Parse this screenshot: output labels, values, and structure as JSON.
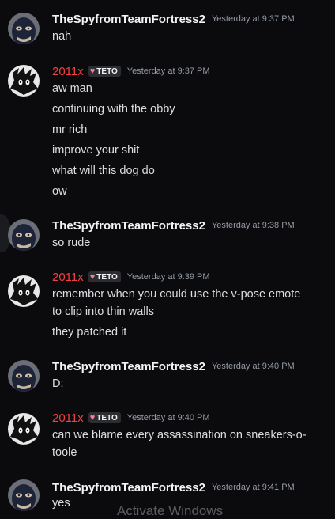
{
  "messages": [
    {
      "user": "TheSpyfromTeamFortress2",
      "time": "Yesterday at 9:37 PM",
      "lines": [
        "nah"
      ]
    },
    {
      "user": "2011x",
      "tag": "TETO",
      "time": "Yesterday at 9:37 PM",
      "lines": [
        "aw man",
        "continuing with the obby",
        "mr rich",
        "improve your shit",
        "what will this dog do",
        "ow"
      ]
    },
    {
      "user": "TheSpyfromTeamFortress2",
      "time": "Yesterday at 9:38 PM",
      "lines": [
        "so rude"
      ]
    },
    {
      "user": "2011x",
      "tag": "TETO",
      "time": "Yesterday at 9:39 PM",
      "lines": [
        "remember when you could use the v-pose emote",
        "to clip into thin walls",
        "they patched it"
      ]
    },
    {
      "user": "TheSpyfromTeamFortress2",
      "time": "Yesterday at 9:40 PM",
      "lines": [
        "D:"
      ]
    },
    {
      "user": "2011x",
      "tag": "TETO",
      "time": "Yesterday at 9:40 PM",
      "lines": [
        "can we blame every assassination on sneakers-o-",
        "toole"
      ]
    },
    {
      "user": "TheSpyfromTeamFortress2",
      "time": "Yesterday at 9:41 PM",
      "lines": [
        "yes"
      ]
    }
  ],
  "overlay": {
    "watermark": "Activate Windows"
  },
  "colors": {
    "background": "#0b0b0e",
    "username_red": "#f23f43",
    "timestamp": "#949ba4",
    "tag_heart": "#f47fa4"
  },
  "icons": {
    "tag_icon": "heart-icon",
    "spy_avatar": "spy-avatar-icon",
    "anime_avatar": "anime-avatar-icon"
  }
}
